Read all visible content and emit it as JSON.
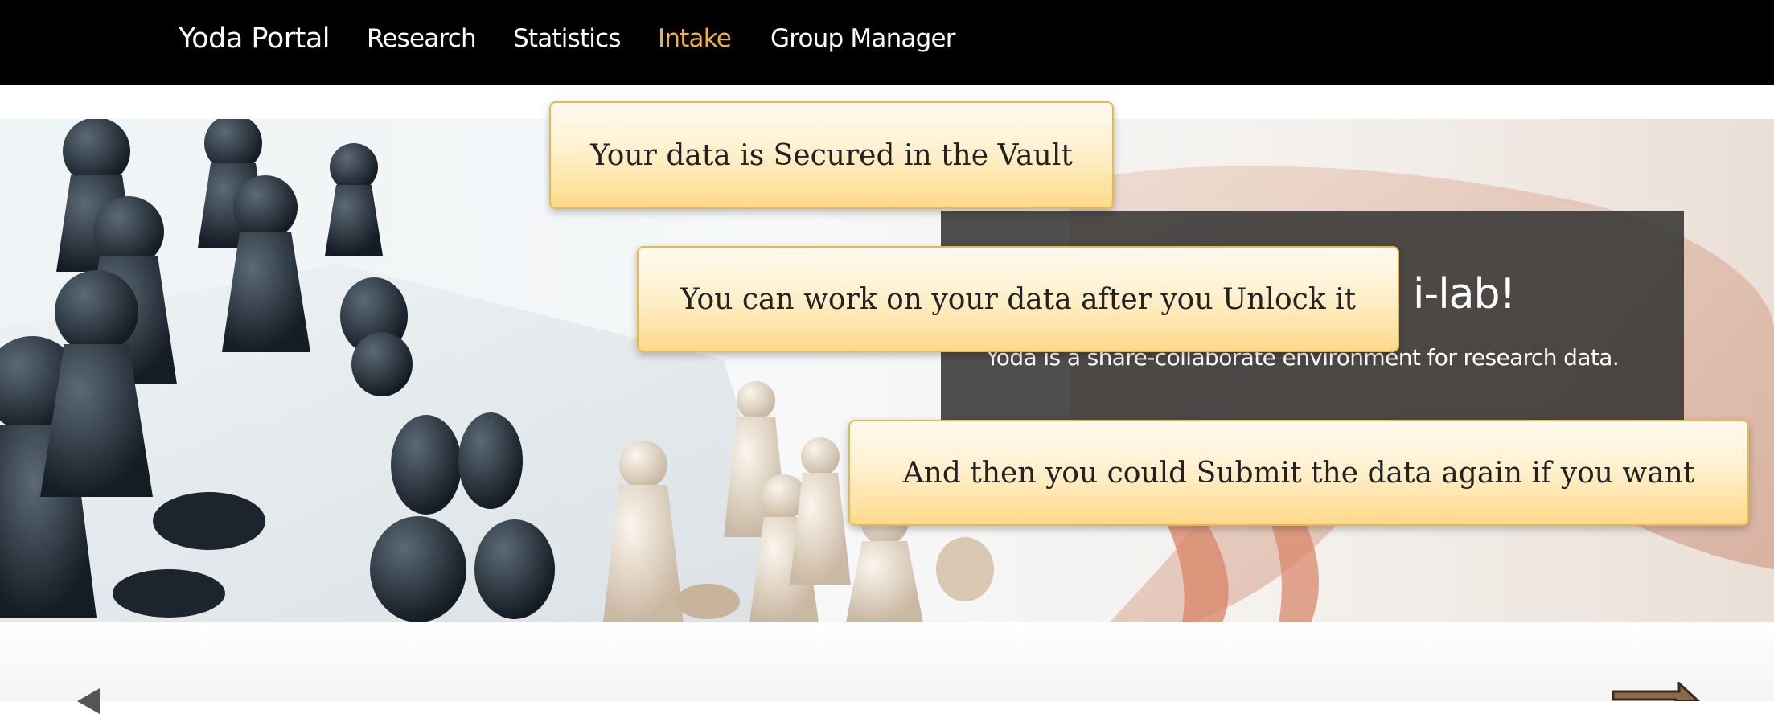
{
  "nav": {
    "brand": "Yoda Portal",
    "links": [
      "Research",
      "Statistics",
      "Intake",
      "Group Manager"
    ],
    "active": "Intake",
    "active_color": "#f2b430"
  },
  "hero": {
    "caption_title": "i-lab!",
    "caption_text": "Yoda is a share-collaborate environment for research data."
  },
  "tooltips": [
    "Your data is Secured in the Vault",
    "You can work on your data after you Unlock it",
    "And then you could Submit the data again if you want"
  ],
  "icons": {
    "prev": "arrow-left-icon",
    "next": "arrow-right-icon"
  }
}
